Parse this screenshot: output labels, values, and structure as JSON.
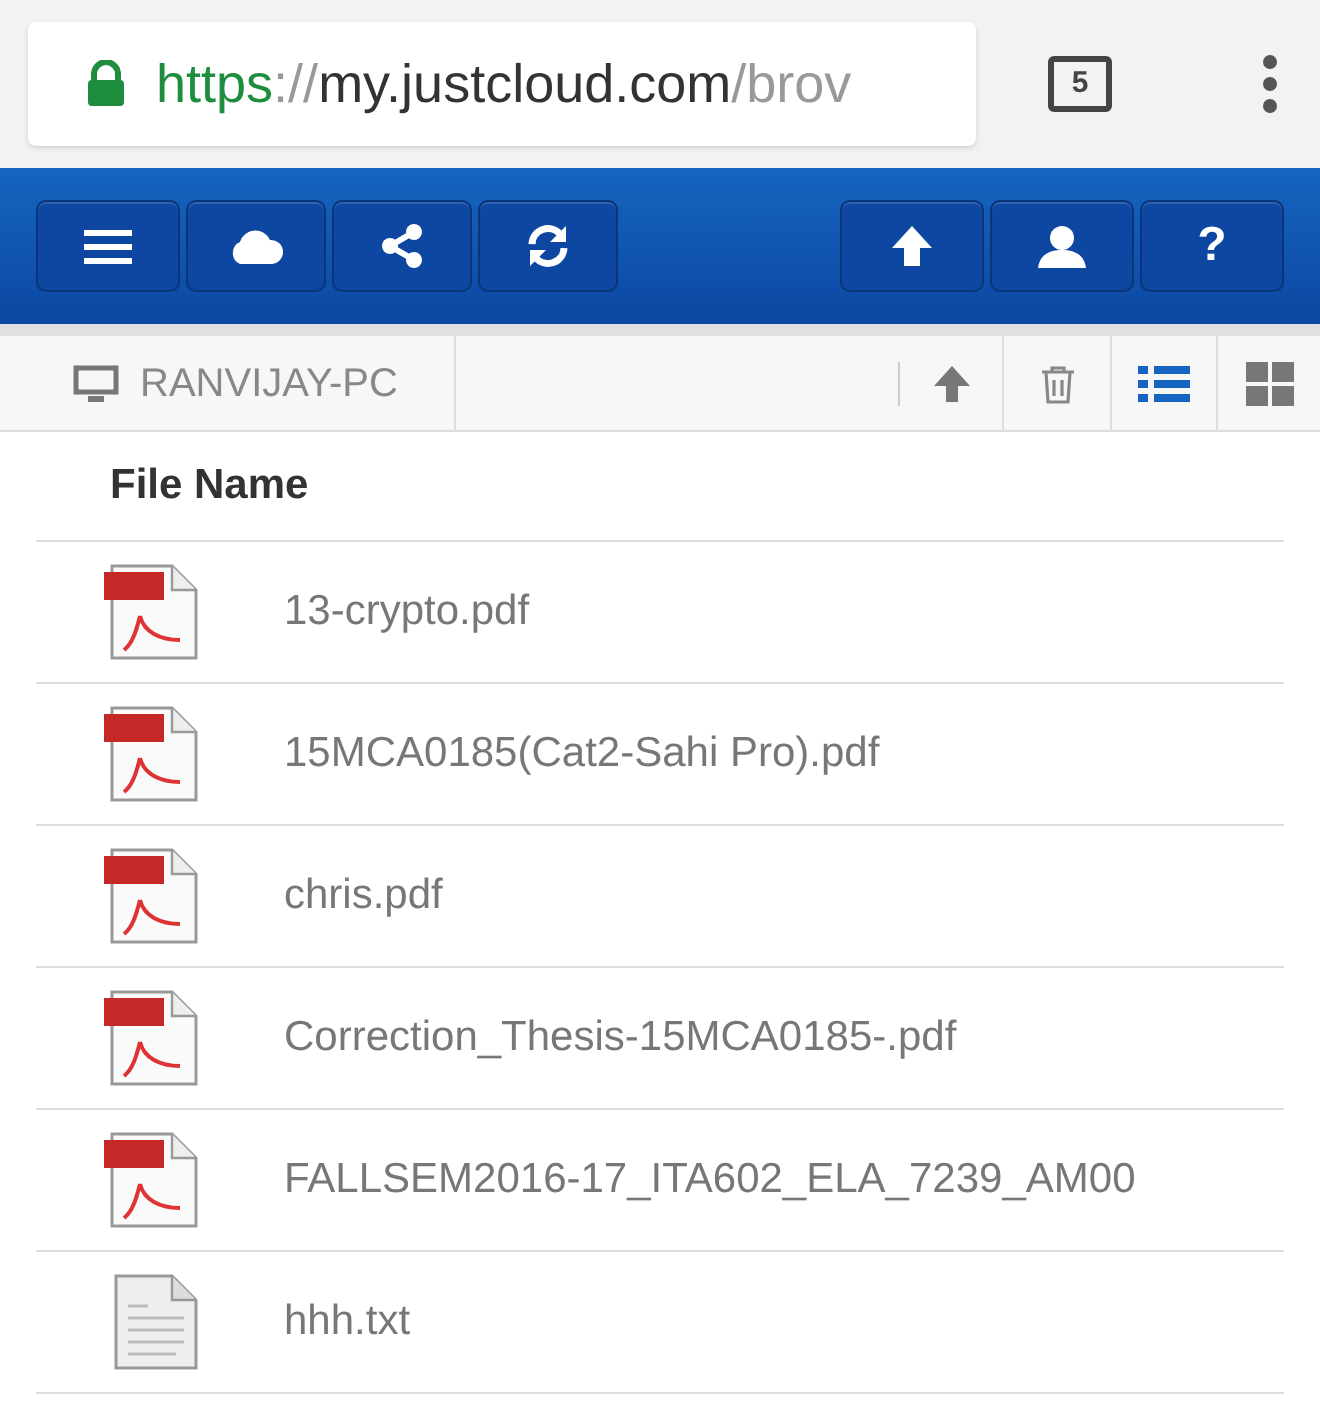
{
  "browser": {
    "address_bar": {
      "scheme": "https",
      "separator": "://",
      "host": "my.justcloud.com",
      "path": "/brov"
    },
    "tab_count": "5"
  },
  "toolbar": {
    "left": [
      {
        "kind": "menu"
      },
      {
        "kind": "cloud"
      },
      {
        "kind": "share"
      },
      {
        "kind": "refresh"
      }
    ],
    "right": [
      {
        "kind": "upload"
      },
      {
        "kind": "user"
      },
      {
        "kind": "help",
        "glyph": "?"
      }
    ]
  },
  "breadcrumb": {
    "label": "RANVIJAY-PC"
  },
  "view_modes": [
    {
      "kind": "list",
      "selected": true
    },
    {
      "kind": "grid",
      "selected": false
    }
  ],
  "table": {
    "columns": [
      "File Name"
    ],
    "rows": [
      {
        "kind": "pdf",
        "name": "13-crypto.pdf"
      },
      {
        "kind": "pdf",
        "name": "15MCA0185(Cat2-Sahi Pro).pdf"
      },
      {
        "kind": "pdf",
        "name": "chris.pdf"
      },
      {
        "kind": "pdf",
        "name": "Correction_Thesis-15MCA0185-.pdf"
      },
      {
        "kind": "pdf",
        "name": "FALLSEM2016-17_ITA602_ELA_7239_AM00"
      },
      {
        "kind": "txt",
        "name": "hhh.txt"
      }
    ]
  }
}
